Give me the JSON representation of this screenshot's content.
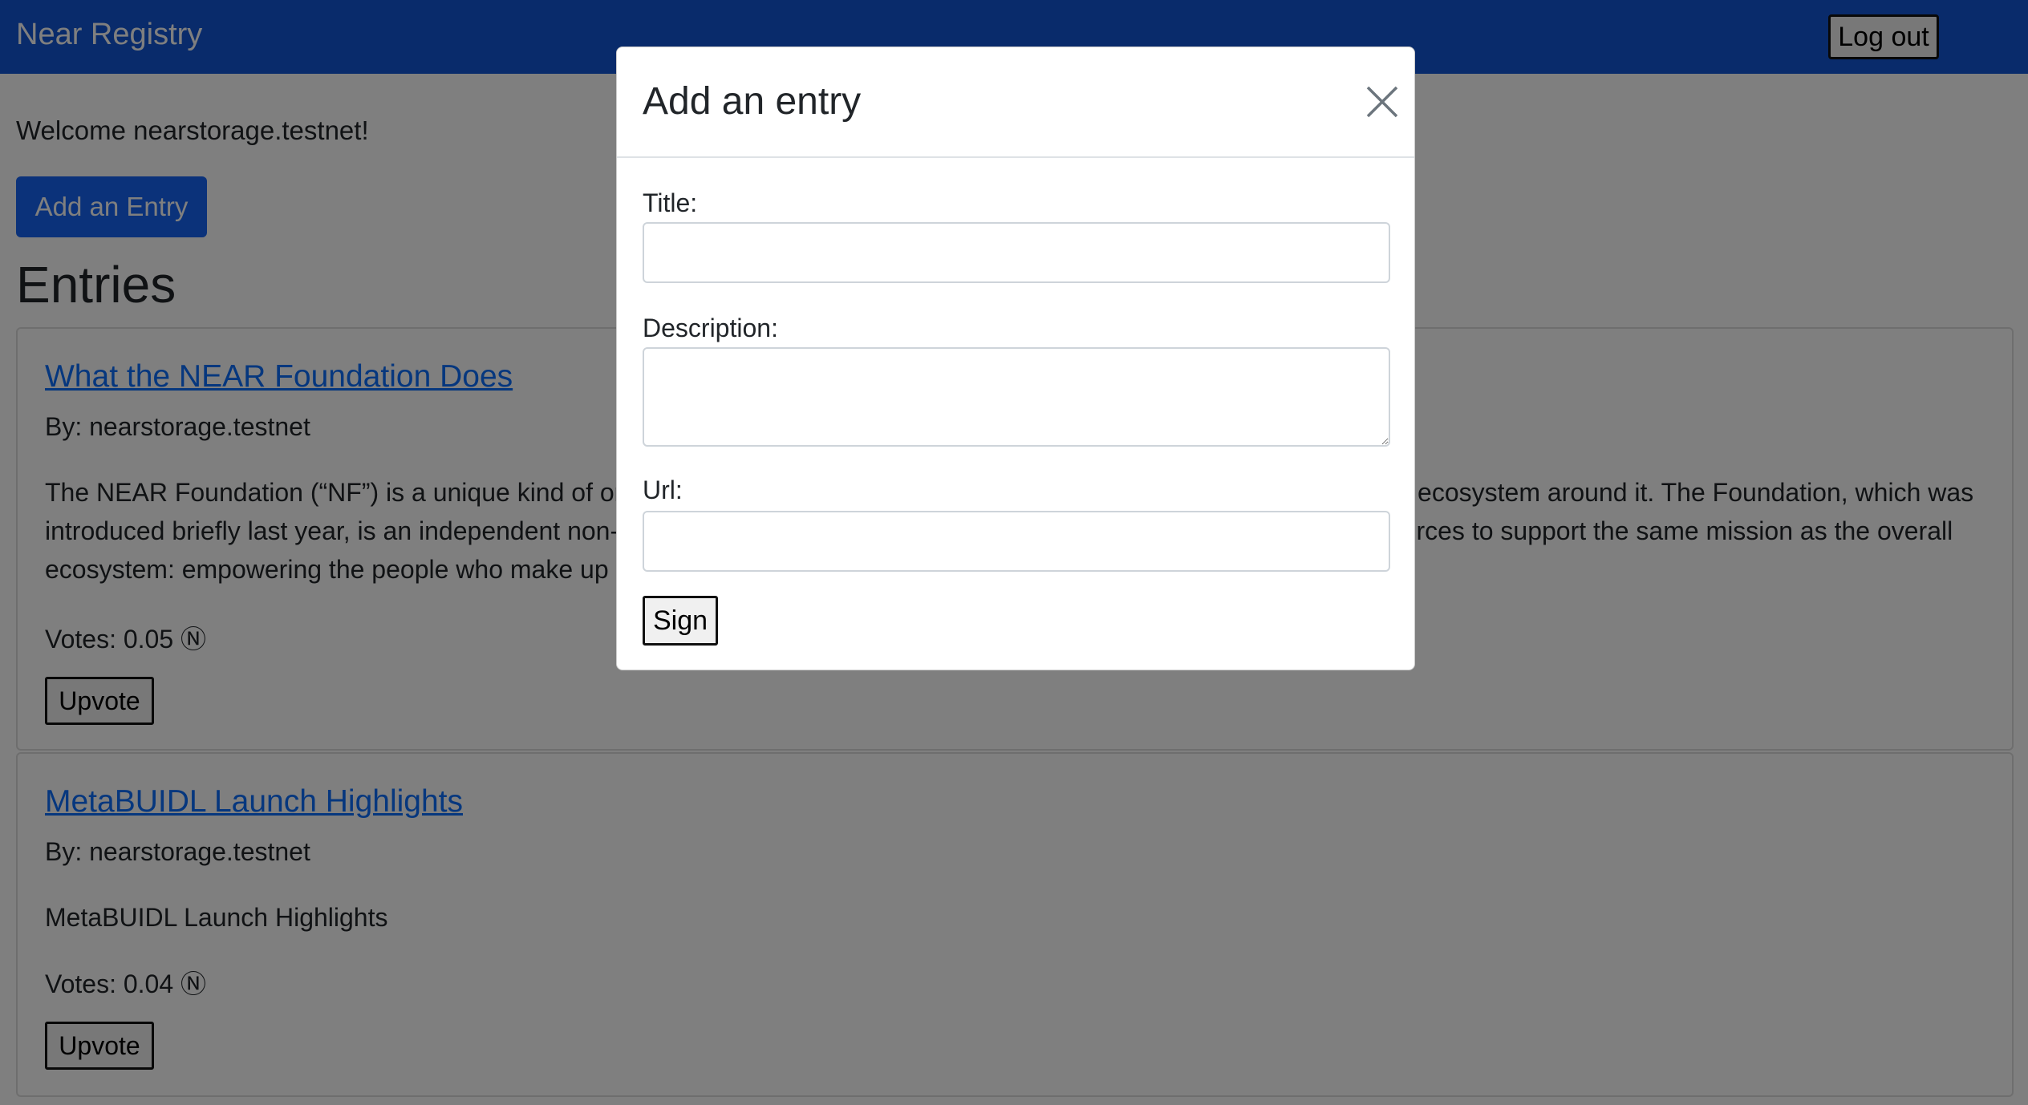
{
  "navbar": {
    "brand": "Near Registry",
    "logout_label": "Log out"
  },
  "main": {
    "welcome": "Welcome nearstorage.testnet!",
    "add_entry_label": "Add an Entry",
    "entries_heading": "Entries",
    "entries": [
      {
        "title": "What the NEAR Foundation Does",
        "by": "By: nearstorage.testnet",
        "description": "The NEAR Foundation (“NF”) is a unique kind of organization whose mission is to support the NEAR Protocol — and the ecosystem around it. The Foundation, which was introduced briefly last year, is an independent non-profit entity which uses the power of its financial and operational resources to support the same mission as the overall ecosystem: empowering the people who make up and drive the NEAR ecosystem.",
        "votes": "Votes: 0.05 Ⓝ",
        "upvote_label": "Upvote"
      },
      {
        "title": "MetaBUIDL Launch Highlights",
        "by": "By: nearstorage.testnet",
        "description": "MetaBUIDL Launch Highlights",
        "votes": "Votes: 0.04 Ⓝ",
        "upvote_label": "Upvote"
      }
    ]
  },
  "modal": {
    "title": "Add an entry",
    "close_icon": "close-icon",
    "title_label": "Title:",
    "title_value": "",
    "description_label": "Description:",
    "description_value": "",
    "url_label": "Url:",
    "url_value": "",
    "sign_label": "Sign"
  },
  "colors": {
    "navbar": "#1256d6",
    "primary": "#1765f5",
    "link": "#0d6efd"
  }
}
